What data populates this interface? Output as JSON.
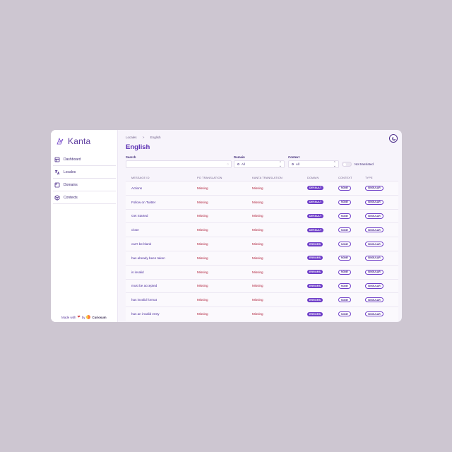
{
  "app": {
    "name": "Kanta"
  },
  "sidebar": {
    "items": [
      {
        "label": "Dashboard",
        "icon": "dashboard-icon"
      },
      {
        "label": "Locales",
        "icon": "translate-icon"
      },
      {
        "label": "Domains",
        "icon": "domains-icon"
      },
      {
        "label": "Contexts",
        "icon": "contexts-icon"
      }
    ],
    "footer": {
      "made_with": "Made with",
      "by": "by",
      "company": "Curiosum"
    }
  },
  "breadcrumb": {
    "root": "Locales",
    "separator": ">",
    "current": "English"
  },
  "page": {
    "title": "English"
  },
  "filters": {
    "search_label": "Search",
    "search_value": "",
    "domain_label": "Domain",
    "domain_value": "All",
    "context_label": "Context",
    "context_value": "All",
    "not_translated_label": "Not translated"
  },
  "table": {
    "headers": [
      "MESSAGE ID",
      "PO TRANSLATION",
      "KANTA TRANSLATION",
      "DOMAIN",
      "CONTEXT",
      "TYPE"
    ],
    "rows": [
      {
        "id": "Actions",
        "po": "Missing",
        "kanta": "Missing",
        "domain": "DEFAULT",
        "context": "NONE",
        "type": "SINGULAR"
      },
      {
        "id": "Follow on Twitter",
        "po": "Missing",
        "kanta": "Missing",
        "domain": "DEFAULT",
        "context": "NONE",
        "type": "SINGULAR"
      },
      {
        "id": "Get Started",
        "po": "Missing",
        "kanta": "Missing",
        "domain": "DEFAULT",
        "context": "NONE",
        "type": "SINGULAR"
      },
      {
        "id": "close",
        "po": "Missing",
        "kanta": "Missing",
        "domain": "DEFAULT",
        "context": "NONE",
        "type": "SINGULAR"
      },
      {
        "id": "can't be blank",
        "po": "Missing",
        "kanta": "Missing",
        "domain": "ERRORS",
        "context": "NONE",
        "type": "SINGULAR"
      },
      {
        "id": "has already been taken",
        "po": "Missing",
        "kanta": "Missing",
        "domain": "ERRORS",
        "context": "NONE",
        "type": "SINGULAR"
      },
      {
        "id": "is invalid",
        "po": "Missing",
        "kanta": "Missing",
        "domain": "ERRORS",
        "context": "NONE",
        "type": "SINGULAR"
      },
      {
        "id": "must be accepted",
        "po": "Missing",
        "kanta": "Missing",
        "domain": "ERRORS",
        "context": "NONE",
        "type": "SINGULAR"
      },
      {
        "id": "has invalid format",
        "po": "Missing",
        "kanta": "Missing",
        "domain": "ERRORS",
        "context": "NONE",
        "type": "SINGULAR"
      },
      {
        "id": "has an invalid entry",
        "po": "Missing",
        "kanta": "Missing",
        "domain": "ERRORS",
        "context": "NONE",
        "type": "SINGULAR"
      }
    ]
  },
  "colors": {
    "accent": "#6f3fc9",
    "missing": "#b0223c",
    "background": "#cdc6d1"
  }
}
